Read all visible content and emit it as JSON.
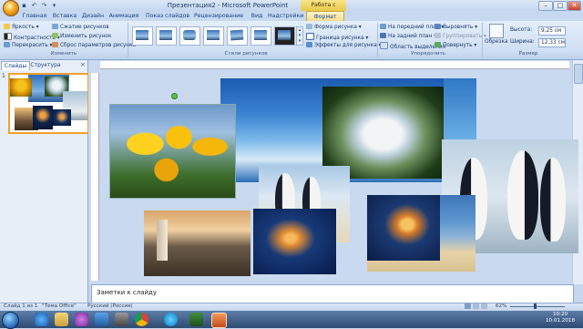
{
  "window": {
    "title": "Презентация2 - Microsoft PowerPoint",
    "context_title": "Работа с рисунками",
    "min_label": "–",
    "max_label": "□",
    "close_label": "✕"
  },
  "quick_access": [
    "▪",
    "↶",
    "↷",
    "▾"
  ],
  "tabs": [
    {
      "label": "Главная"
    },
    {
      "label": "Вставка"
    },
    {
      "label": "Дизайн"
    },
    {
      "label": "Анимация"
    },
    {
      "label": "Показ слайдов"
    },
    {
      "label": "Рецензирование"
    },
    {
      "label": "Вид"
    },
    {
      "label": "Надстройки"
    },
    {
      "label": "Формат"
    }
  ],
  "ribbon": {
    "adjust": {
      "items": [
        "Яркость ▾",
        "Контрастность ▾",
        "Перекрасить ▾",
        "Сжатие рисунков",
        "Изменить рисунок",
        "Сброс параметров рисунка"
      ],
      "label": "Изменить"
    },
    "styles": {
      "label": "Стили рисунков",
      "items": [
        "Форма рисунка ▾",
        "Граница рисунка ▾",
        "Эффекты для рисунка ▾"
      ]
    },
    "arrange": {
      "items": [
        "На передний план ▾",
        "На задний план ▾",
        "Область выделения",
        "Выровнять ▾",
        "Группировать ▾",
        "Повернуть ▾"
      ],
      "label": "Упорядочить"
    },
    "size": {
      "crop_label": "Обрезка",
      "height_label": "Высота:",
      "height_value": "9,25 см",
      "width_label": "Ширина:",
      "width_value": "12,33 см",
      "label": "Размер"
    }
  },
  "left_pane": {
    "tab_slides": "Слайды",
    "tab_outline": "Структура",
    "close": "×",
    "slide_number": "1"
  },
  "notes_placeholder": "Заметки к слайду",
  "status": {
    "slide": "Слайд 1 из 1",
    "theme": "\"Тема Office\"",
    "language": "Русский (Россия)",
    "zoom": "62%"
  },
  "clock": {
    "time": "10:20",
    "date": "10.01.2018"
  },
  "colors": {
    "accent": "#f0a030",
    "ribbon": "#dbe7f6"
  }
}
